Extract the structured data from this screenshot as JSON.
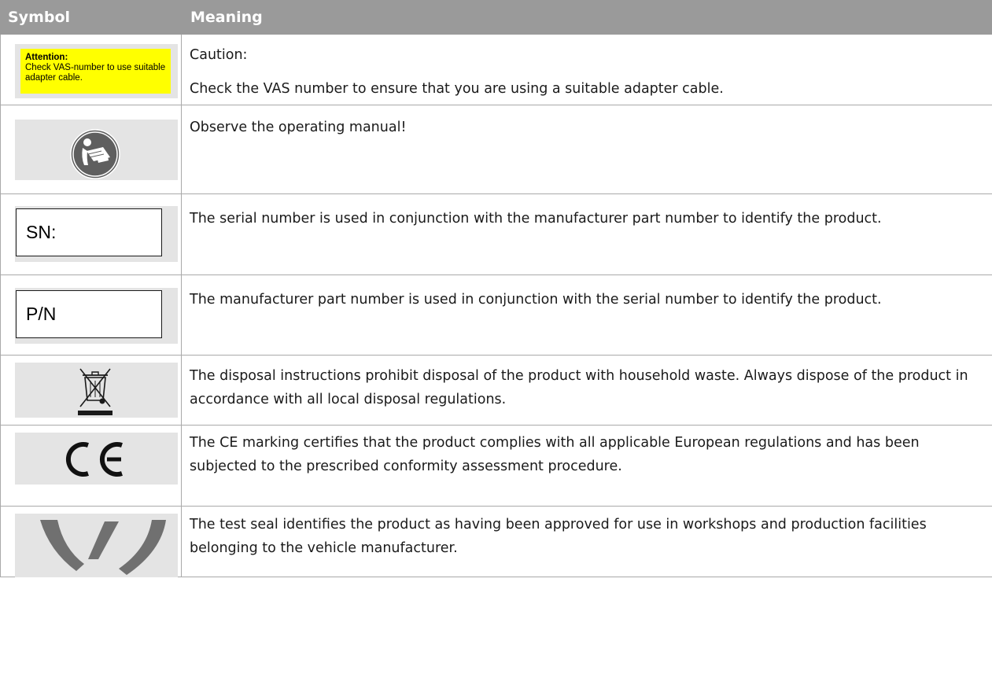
{
  "header": {
    "symbol": "Symbol",
    "meaning": "Meaning"
  },
  "rows": [
    {
      "icon": "attention-label",
      "label_title": "Attention:",
      "label_text": "Check VAS-number to use suitable adapter cable.",
      "label_color": "#ffff00",
      "meaning_lines": [
        "Caution:",
        "Check the VAS number to ensure that you are using a suitable adapter cable."
      ]
    },
    {
      "icon": "read-manual-icon",
      "meaning": "Observe the operating manual!"
    },
    {
      "icon": "serial-number-label",
      "label": "SN:",
      "meaning": "The serial number is used in conjunction with the manufacturer part number to identify the product."
    },
    {
      "icon": "part-number-label",
      "label": "P/N",
      "meaning": "The manufacturer part number is used in conjunction with the serial number to identify the product."
    },
    {
      "icon": "weee-crossed-bin-icon",
      "meaning": "The disposal instructions prohibit disposal of the product with household waste. Always dispose of the product in accordance with all local disposal regulations."
    },
    {
      "icon": "ce-mark-icon",
      "meaning": "The CE marking certifies that the product complies with all applicable European regulations and has been subjected to the prescribed conformity assessment procedure."
    },
    {
      "icon": "test-seal-icon",
      "meaning": "The test seal identifies the product as having been approved for use in workshops and production facilities belonging to the vehicle manufacturer."
    }
  ]
}
